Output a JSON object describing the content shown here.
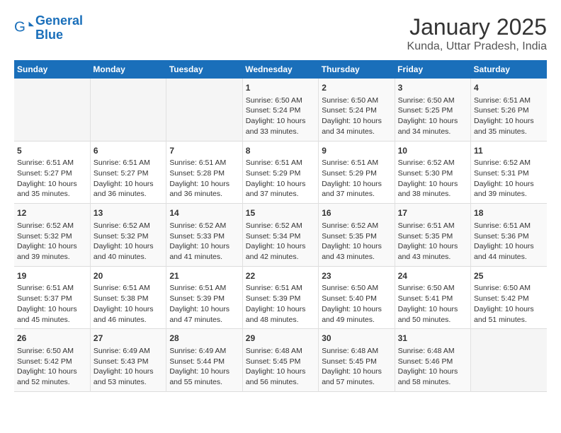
{
  "header": {
    "logo_line1": "General",
    "logo_line2": "Blue",
    "title": "January 2025",
    "subtitle": "Kunda, Uttar Pradesh, India"
  },
  "days_of_week": [
    "Sunday",
    "Monday",
    "Tuesday",
    "Wednesday",
    "Thursday",
    "Friday",
    "Saturday"
  ],
  "weeks": [
    [
      {
        "day": "",
        "sunrise": "",
        "sunset": "",
        "daylight": ""
      },
      {
        "day": "",
        "sunrise": "",
        "sunset": "",
        "daylight": ""
      },
      {
        "day": "",
        "sunrise": "",
        "sunset": "",
        "daylight": ""
      },
      {
        "day": "1",
        "sunrise": "Sunrise: 6:50 AM",
        "sunset": "Sunset: 5:24 PM",
        "daylight": "Daylight: 10 hours and 33 minutes."
      },
      {
        "day": "2",
        "sunrise": "Sunrise: 6:50 AM",
        "sunset": "Sunset: 5:24 PM",
        "daylight": "Daylight: 10 hours and 34 minutes."
      },
      {
        "day": "3",
        "sunrise": "Sunrise: 6:50 AM",
        "sunset": "Sunset: 5:25 PM",
        "daylight": "Daylight: 10 hours and 34 minutes."
      },
      {
        "day": "4",
        "sunrise": "Sunrise: 6:51 AM",
        "sunset": "Sunset: 5:26 PM",
        "daylight": "Daylight: 10 hours and 35 minutes."
      }
    ],
    [
      {
        "day": "5",
        "sunrise": "Sunrise: 6:51 AM",
        "sunset": "Sunset: 5:27 PM",
        "daylight": "Daylight: 10 hours and 35 minutes."
      },
      {
        "day": "6",
        "sunrise": "Sunrise: 6:51 AM",
        "sunset": "Sunset: 5:27 PM",
        "daylight": "Daylight: 10 hours and 36 minutes."
      },
      {
        "day": "7",
        "sunrise": "Sunrise: 6:51 AM",
        "sunset": "Sunset: 5:28 PM",
        "daylight": "Daylight: 10 hours and 36 minutes."
      },
      {
        "day": "8",
        "sunrise": "Sunrise: 6:51 AM",
        "sunset": "Sunset: 5:29 PM",
        "daylight": "Daylight: 10 hours and 37 minutes."
      },
      {
        "day": "9",
        "sunrise": "Sunrise: 6:51 AM",
        "sunset": "Sunset: 5:29 PM",
        "daylight": "Daylight: 10 hours and 37 minutes."
      },
      {
        "day": "10",
        "sunrise": "Sunrise: 6:52 AM",
        "sunset": "Sunset: 5:30 PM",
        "daylight": "Daylight: 10 hours and 38 minutes."
      },
      {
        "day": "11",
        "sunrise": "Sunrise: 6:52 AM",
        "sunset": "Sunset: 5:31 PM",
        "daylight": "Daylight: 10 hours and 39 minutes."
      }
    ],
    [
      {
        "day": "12",
        "sunrise": "Sunrise: 6:52 AM",
        "sunset": "Sunset: 5:32 PM",
        "daylight": "Daylight: 10 hours and 39 minutes."
      },
      {
        "day": "13",
        "sunrise": "Sunrise: 6:52 AM",
        "sunset": "Sunset: 5:32 PM",
        "daylight": "Daylight: 10 hours and 40 minutes."
      },
      {
        "day": "14",
        "sunrise": "Sunrise: 6:52 AM",
        "sunset": "Sunset: 5:33 PM",
        "daylight": "Daylight: 10 hours and 41 minutes."
      },
      {
        "day": "15",
        "sunrise": "Sunrise: 6:52 AM",
        "sunset": "Sunset: 5:34 PM",
        "daylight": "Daylight: 10 hours and 42 minutes."
      },
      {
        "day": "16",
        "sunrise": "Sunrise: 6:52 AM",
        "sunset": "Sunset: 5:35 PM",
        "daylight": "Daylight: 10 hours and 43 minutes."
      },
      {
        "day": "17",
        "sunrise": "Sunrise: 6:51 AM",
        "sunset": "Sunset: 5:35 PM",
        "daylight": "Daylight: 10 hours and 43 minutes."
      },
      {
        "day": "18",
        "sunrise": "Sunrise: 6:51 AM",
        "sunset": "Sunset: 5:36 PM",
        "daylight": "Daylight: 10 hours and 44 minutes."
      }
    ],
    [
      {
        "day": "19",
        "sunrise": "Sunrise: 6:51 AM",
        "sunset": "Sunset: 5:37 PM",
        "daylight": "Daylight: 10 hours and 45 minutes."
      },
      {
        "day": "20",
        "sunrise": "Sunrise: 6:51 AM",
        "sunset": "Sunset: 5:38 PM",
        "daylight": "Daylight: 10 hours and 46 minutes."
      },
      {
        "day": "21",
        "sunrise": "Sunrise: 6:51 AM",
        "sunset": "Sunset: 5:39 PM",
        "daylight": "Daylight: 10 hours and 47 minutes."
      },
      {
        "day": "22",
        "sunrise": "Sunrise: 6:51 AM",
        "sunset": "Sunset: 5:39 PM",
        "daylight": "Daylight: 10 hours and 48 minutes."
      },
      {
        "day": "23",
        "sunrise": "Sunrise: 6:50 AM",
        "sunset": "Sunset: 5:40 PM",
        "daylight": "Daylight: 10 hours and 49 minutes."
      },
      {
        "day": "24",
        "sunrise": "Sunrise: 6:50 AM",
        "sunset": "Sunset: 5:41 PM",
        "daylight": "Daylight: 10 hours and 50 minutes."
      },
      {
        "day": "25",
        "sunrise": "Sunrise: 6:50 AM",
        "sunset": "Sunset: 5:42 PM",
        "daylight": "Daylight: 10 hours and 51 minutes."
      }
    ],
    [
      {
        "day": "26",
        "sunrise": "Sunrise: 6:50 AM",
        "sunset": "Sunset: 5:42 PM",
        "daylight": "Daylight: 10 hours and 52 minutes."
      },
      {
        "day": "27",
        "sunrise": "Sunrise: 6:49 AM",
        "sunset": "Sunset: 5:43 PM",
        "daylight": "Daylight: 10 hours and 53 minutes."
      },
      {
        "day": "28",
        "sunrise": "Sunrise: 6:49 AM",
        "sunset": "Sunset: 5:44 PM",
        "daylight": "Daylight: 10 hours and 55 minutes."
      },
      {
        "day": "29",
        "sunrise": "Sunrise: 6:48 AM",
        "sunset": "Sunset: 5:45 PM",
        "daylight": "Daylight: 10 hours and 56 minutes."
      },
      {
        "day": "30",
        "sunrise": "Sunrise: 6:48 AM",
        "sunset": "Sunset: 5:45 PM",
        "daylight": "Daylight: 10 hours and 57 minutes."
      },
      {
        "day": "31",
        "sunrise": "Sunrise: 6:48 AM",
        "sunset": "Sunset: 5:46 PM",
        "daylight": "Daylight: 10 hours and 58 minutes."
      },
      {
        "day": "",
        "sunrise": "",
        "sunset": "",
        "daylight": ""
      }
    ]
  ]
}
